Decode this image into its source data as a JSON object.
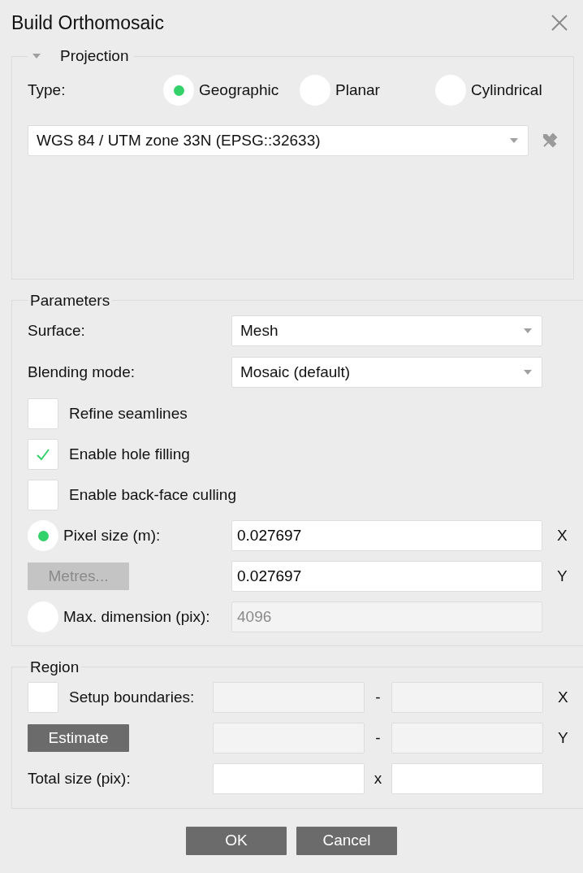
{
  "dialog": {
    "title": "Build Orthomosaic"
  },
  "projection": {
    "title": "Projection",
    "expanded": true,
    "type_label": "Type:",
    "types": [
      {
        "label": "Geographic",
        "selected": true
      },
      {
        "label": "Planar",
        "selected": false
      },
      {
        "label": "Cylindrical",
        "selected": false
      }
    ],
    "crs": {
      "value": "WGS 84 / UTM zone 33N (EPSG::32633)"
    }
  },
  "parameters": {
    "title": "Parameters",
    "selects": [
      {
        "label": "Surface:",
        "value": "Mesh"
      },
      {
        "label": "Blending mode:",
        "value": "Mosaic (default)"
      }
    ],
    "options": [
      {
        "label": "Refine seamlines",
        "checked": false
      },
      {
        "label": "Enable hole filling",
        "checked": true
      },
      {
        "label": "Enable back-face culling",
        "checked": false
      }
    ],
    "pixel_size": {
      "label": "Pixel size (m):",
      "selected": true,
      "x_value": "0.027697",
      "x_axis": "X",
      "units_button": {
        "label": "Metres...",
        "disabled": true
      },
      "y_value": "0.027697",
      "y_axis": "Y"
    },
    "max_dimension": {
      "label": "Max. dimension (pix):",
      "selected": false,
      "value": "4096",
      "disabled": true
    }
  },
  "region": {
    "title": "Region",
    "setup": {
      "label": "Setup boundaries:",
      "checked": false
    },
    "rows": [
      {
        "kind": "boundary",
        "separator": "-",
        "axis": "X"
      },
      {
        "kind": "estimate",
        "button": "Estimate",
        "separator": "-",
        "axis": "Y"
      },
      {
        "kind": "total",
        "label": "Total size (pix):",
        "separator": "x"
      }
    ]
  },
  "buttons": [
    {
      "label": "OK"
    },
    {
      "label": "Cancel"
    }
  ]
}
